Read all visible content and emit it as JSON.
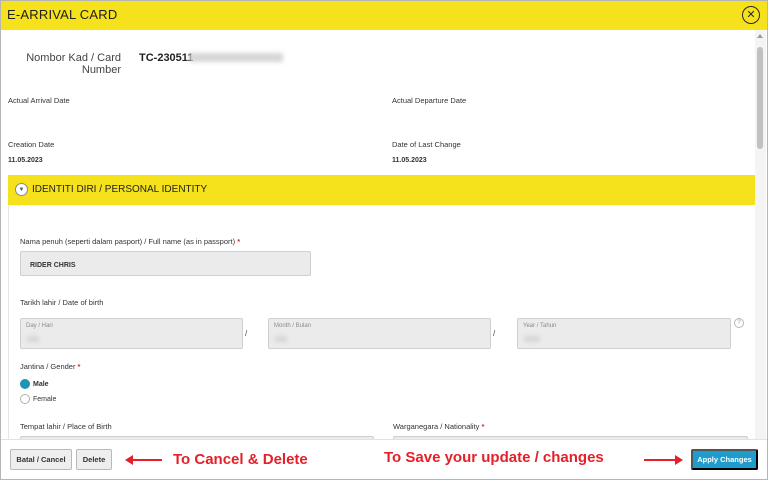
{
  "window": {
    "title": "E-ARRIVAL CARD",
    "close_icon": "close-circle-icon"
  },
  "card_info": {
    "number_label": "Nombor Kad / Card Number",
    "number_prefix": "TC-230511"
  },
  "dates": {
    "arrival_label": "Actual Arrival Date",
    "departure_label": "Actual Departure Date",
    "creation_label": "Creation Date",
    "creation_value": "11.05.2023",
    "last_change_label": "Date of Last Change",
    "last_change_value": "11.05.2023"
  },
  "section": {
    "title": "IDENTITI DIRI / PERSONAL IDENTITY",
    "toggle_icon": "chevron-down-icon"
  },
  "form": {
    "full_name_label": "Nama penuh (seperti dalam pasport) / Full name (as in passport)",
    "full_name_value": "RIDER CHRIS",
    "dob_label": "Tarikh lahir / Date of birth",
    "day_placeholder": "Day / Hari",
    "month_placeholder": "Month / Bulan",
    "year_placeholder": "Year / Tahun",
    "separator": "/",
    "help_icon": "question-circle-icon",
    "gender_label": "Jantina / Gender",
    "gender_options": [
      "Male",
      "Female"
    ],
    "gender_selected": "Male",
    "birth_place_label": "Tempat lahir / Place of Birth",
    "nationality_label": "Warganegara / Nationality",
    "required_marker": "*"
  },
  "footer": {
    "cancel_label": "Batal / Cancel",
    "delete_label": "Delete",
    "apply_label": "Apply Changes",
    "cancel_annotation": "To Cancel & Delete",
    "save_annotation": "To Save your update / changes"
  },
  "colors": {
    "accent_yellow": "#f5e11c",
    "primary_blue": "#1f9ccc",
    "annotation_red": "#e4202a",
    "radio_selected": "#1f95b5"
  }
}
